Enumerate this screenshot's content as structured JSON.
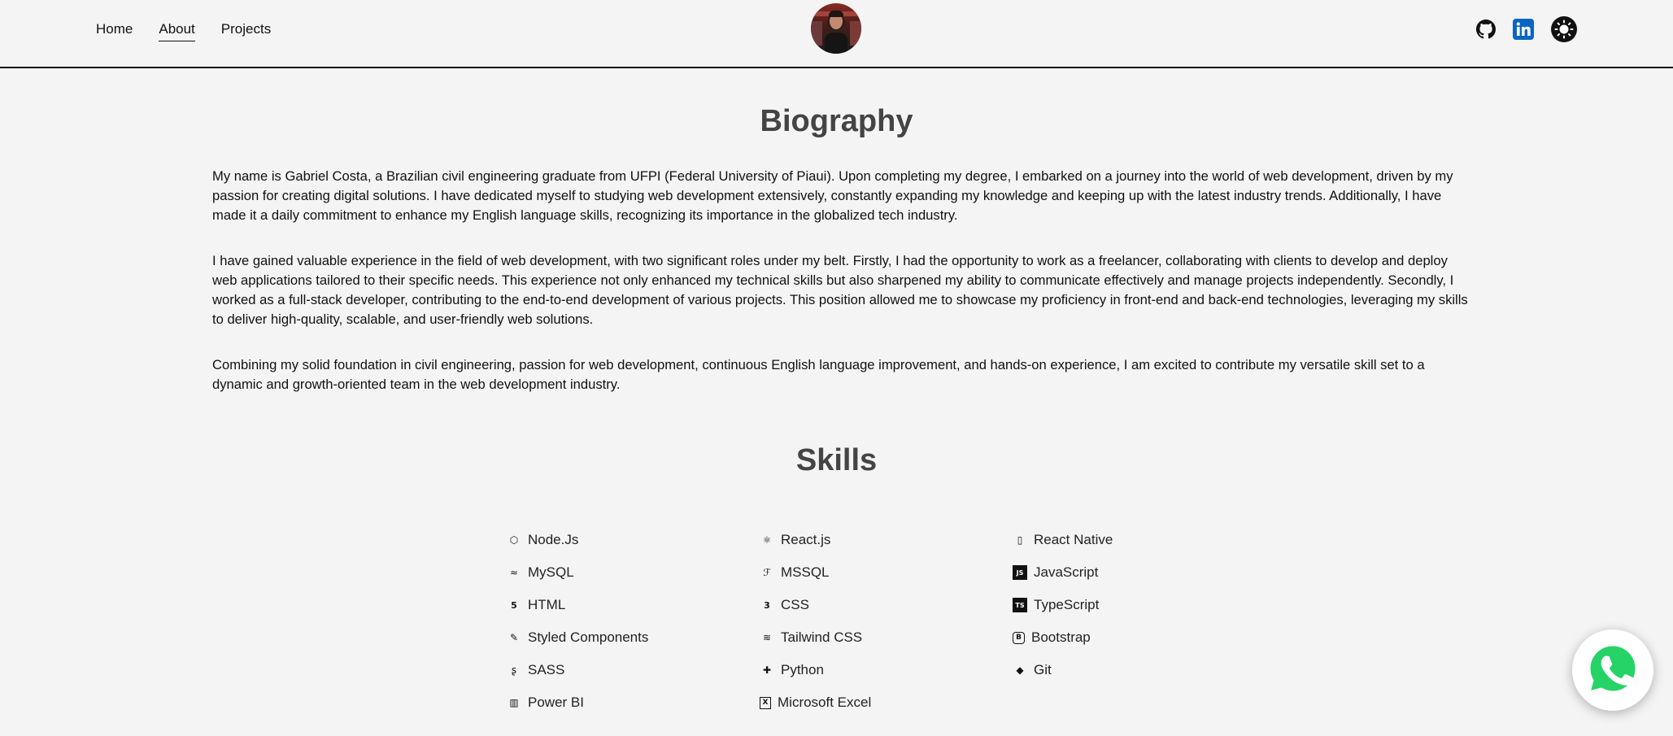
{
  "nav": {
    "items": [
      {
        "label": "Home",
        "active": false
      },
      {
        "label": "About",
        "active": true
      },
      {
        "label": "Projects",
        "active": false
      }
    ]
  },
  "header": {
    "icons": [
      "github-icon",
      "linkedin-icon",
      "theme-toggle-icon"
    ]
  },
  "biography": {
    "title": "Biography",
    "paragraphs": [
      "My name is Gabriel Costa, a Brazilian civil engineering graduate from UFPI (Federal University of Piaui). Upon completing my degree, I embarked on a journey into the world of web development, driven by my passion for creating digital solutions. I have dedicated myself to studying web development extensively, constantly expanding my knowledge and keeping up with the latest industry trends. Additionally, I have made it a daily commitment to enhance my English language skills, recognizing its importance in the globalized tech industry.",
      "I have gained valuable experience in the field of web development, with two significant roles under my belt. Firstly, I had the opportunity to work as a freelancer, collaborating with clients to develop and deploy web applications tailored to their specific needs. This experience not only enhanced my technical skills but also sharpened my ability to communicate effectively and manage projects independently. Secondly, I worked as a full-stack developer, contributing to the end-to-end development of various projects. This position allowed me to showcase my proficiency in front-end and back-end technologies, leveraging my skills to deliver high-quality, scalable, and user-friendly web solutions.",
      "Combining my solid foundation in civil engineering, passion for web development, continuous English language improvement, and hands-on experience, I am excited to contribute my versatile skill set to a dynamic and growth-oriented team in the web development industry."
    ]
  },
  "skills": {
    "title": "Skills",
    "items": [
      {
        "label": "Node.Js",
        "icon": "nodejs-icon",
        "glyph": "⬡"
      },
      {
        "label": "React.js",
        "icon": "react-icon",
        "glyph": "⚛"
      },
      {
        "label": "React Native",
        "icon": "mobile-icon",
        "glyph": "▯"
      },
      {
        "label": "MySQL",
        "icon": "mysql-icon",
        "glyph": "≈"
      },
      {
        "label": "MSSQL",
        "icon": "mssql-icon",
        "glyph": "ℱ"
      },
      {
        "label": "JavaScript",
        "icon": "javascript-icon",
        "glyph": "JS"
      },
      {
        "label": "HTML",
        "icon": "html-icon",
        "glyph": "5"
      },
      {
        "label": "CSS",
        "icon": "css-icon",
        "glyph": "3"
      },
      {
        "label": "TypeScript",
        "icon": "typescript-icon",
        "glyph": "TS"
      },
      {
        "label": "Styled Components",
        "icon": "styled-components-icon",
        "glyph": "✎"
      },
      {
        "label": "Tailwind CSS",
        "icon": "tailwind-icon",
        "glyph": "≋"
      },
      {
        "label": "Bootstrap",
        "icon": "bootstrap-icon",
        "glyph": "B"
      },
      {
        "label": "SASS",
        "icon": "sass-icon",
        "glyph": "ʂ"
      },
      {
        "label": "Python",
        "icon": "python-icon",
        "glyph": "✚"
      },
      {
        "label": "Git",
        "icon": "git-icon",
        "glyph": "◆"
      },
      {
        "label": "Power BI",
        "icon": "powerbi-icon",
        "glyph": "▥"
      },
      {
        "label": "Microsoft Excel",
        "icon": "excel-icon",
        "glyph": "X"
      }
    ]
  },
  "colors": {
    "background": "#f4f4f4",
    "heading": "#444444",
    "linkedin": "#0a66c2",
    "whatsapp": "#25d366"
  },
  "fab": {
    "icon": "whatsapp-icon"
  }
}
